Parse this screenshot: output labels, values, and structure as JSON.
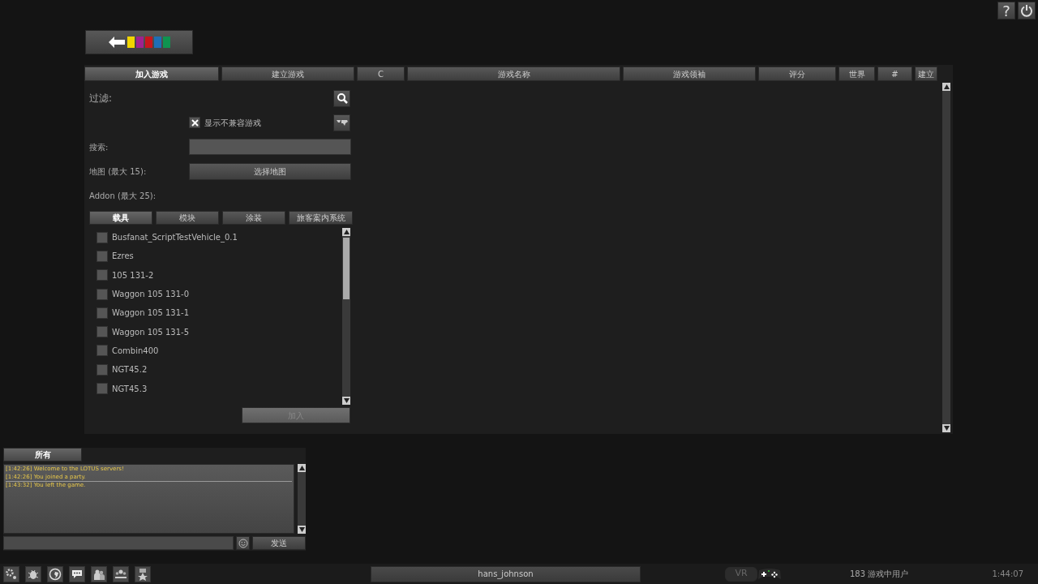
{
  "top_buttons": [
    {
      "kind": "help",
      "label": "?"
    },
    {
      "kind": "power"
    }
  ],
  "columns": [
    {
      "label": "加入游戏",
      "selected": true
    },
    {
      "label": "建立游戏",
      "selected": false
    },
    {
      "label": "C",
      "selected": false
    },
    {
      "label": "游戏名称",
      "selected": false
    },
    {
      "label": "游戏领袖",
      "selected": false
    },
    {
      "label": "评分",
      "selected": false
    },
    {
      "label": "世界",
      "selected": false
    },
    {
      "label": "#",
      "selected": false
    },
    {
      "label": "建立",
      "selected": false
    }
  ],
  "filter": {
    "title": "过滤:",
    "show_incompatible": {
      "label": "显示不兼容游戏",
      "checked": true
    },
    "search_label": "搜索:",
    "map_label": "地图 (最大 15):",
    "map_button": "选择地图",
    "addon_label": "Addon (最大 25):",
    "addon_tabs": [
      {
        "label": "载具",
        "selected": true
      },
      {
        "label": "模块",
        "selected": false
      },
      {
        "label": "涂装",
        "selected": false
      },
      {
        "label": "旅客案内系统",
        "selected": false
      }
    ],
    "addons": [
      {
        "label": "Busfanat_ScriptTestVehicle_0.1",
        "checked": false
      },
      {
        "label": "Ezres",
        "checked": false
      },
      {
        "label": "105 131-2",
        "checked": false
      },
      {
        "label": "Waggon 105 131-0",
        "checked": false
      },
      {
        "label": "Waggon 105 131-1",
        "checked": false
      },
      {
        "label": "Waggon 105 131-5",
        "checked": false
      },
      {
        "label": "Combin400",
        "checked": false
      },
      {
        "label": "NGT45.2",
        "checked": false
      },
      {
        "label": "NGT45.3",
        "checked": false
      }
    ],
    "add_button": {
      "label": "加入",
      "disabled": true
    }
  },
  "chat": {
    "tabs": [
      {
        "label": "所有",
        "selected": true
      }
    ],
    "messages": [
      {
        "time": "[1:42:26]",
        "text": "Welcome  to the LOTUS  servers!"
      },
      {
        "time": "[1:42:26]",
        "text": "You joined a party."
      },
      {
        "time": "[1:43:32]",
        "text": "You left the game."
      }
    ],
    "send_button": "发送"
  },
  "taskbar": {
    "username": "hans_johnson",
    "vr": {
      "label": "VR",
      "on": false
    },
    "users_online": "183 游戏中用户",
    "clock": "1:44:07"
  }
}
